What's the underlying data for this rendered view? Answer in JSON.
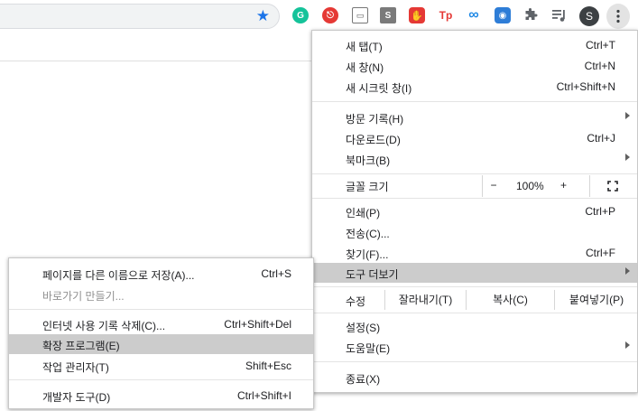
{
  "colors": {
    "accent": "#1a73e8",
    "highlight": "#cccccc"
  },
  "toolbar": {
    "profile_initial": "S",
    "extensions": [
      {
        "name": "grammarly-icon",
        "glyph": "G",
        "bg": "#15c39a"
      },
      {
        "name": "red-extension-icon",
        "glyph": "⎋",
        "bg": "#e53935"
      },
      {
        "name": "screen-extension-icon",
        "glyph": "▭",
        "bg": "#6d6d6d"
      },
      {
        "name": "s-extension-icon",
        "glyph": "S",
        "bg": "#7a7a7a"
      },
      {
        "name": "hand-extension-icon",
        "glyph": "✋",
        "bg": "#e53935"
      },
      {
        "name": "tp-extension-icon",
        "glyph": "Tp",
        "bg": "#ffffff"
      },
      {
        "name": "infinity-extension-icon",
        "glyph": "∞",
        "bg": "#1e88e5"
      },
      {
        "name": "camera-extension-icon",
        "glyph": "◉",
        "bg": "#2e7dd7"
      }
    ]
  },
  "main_menu": {
    "new_tab": {
      "label": "새 탭(T)",
      "shortcut": "Ctrl+T"
    },
    "new_window": {
      "label": "새 창(N)",
      "shortcut": "Ctrl+N"
    },
    "new_incognito": {
      "label": "새 시크릿 창(I)",
      "shortcut": "Ctrl+Shift+N"
    },
    "history": {
      "label": "방문 기록(H)"
    },
    "downloads": {
      "label": "다운로드(D)",
      "shortcut": "Ctrl+J"
    },
    "bookmarks": {
      "label": "북마크(B)"
    },
    "zoom": {
      "label": "글꼴 크기",
      "minus": "−",
      "value": "100%",
      "plus": "+"
    },
    "print": {
      "label": "인쇄(P)",
      "shortcut": "Ctrl+P"
    },
    "cast": {
      "label": "전송(C)..."
    },
    "find": {
      "label": "찾기(F)...",
      "shortcut": "Ctrl+F"
    },
    "more_tools": {
      "label": "도구 더보기"
    },
    "edit": {
      "label": "수정",
      "cut": "잘라내기(T)",
      "copy": "복사(C)",
      "paste": "붙여넣기(P)"
    },
    "settings": {
      "label": "설정(S)"
    },
    "help": {
      "label": "도움말(E)"
    },
    "exit": {
      "label": "종료(X)"
    }
  },
  "sub_menu": {
    "save_page": {
      "label": "페이지를 다른 이름으로 저장(A)...",
      "shortcut": "Ctrl+S"
    },
    "create_shortcut": {
      "label": "바로가기 만들기..."
    },
    "clear_data": {
      "label": "인터넷 사용 기록 삭제(C)...",
      "shortcut": "Ctrl+Shift+Del"
    },
    "extensions": {
      "label": "확장 프로그램(E)"
    },
    "task_manager": {
      "label": "작업 관리자(T)",
      "shortcut": "Shift+Esc"
    },
    "dev_tools": {
      "label": "개발자 도구(D)",
      "shortcut": "Ctrl+Shift+I"
    }
  }
}
